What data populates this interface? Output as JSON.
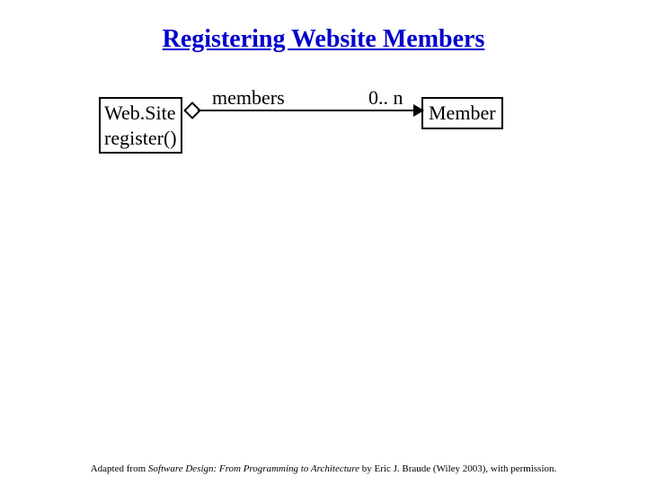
{
  "title": "Registering Website Members",
  "classes": {
    "website": {
      "name": "Web.Site",
      "operation": "register()"
    },
    "member": {
      "name": "Member"
    }
  },
  "association": {
    "role": "members",
    "multiplicity": "0.. n"
  },
  "attribution": {
    "prefix": "Adapted from ",
    "work": "Software Design: From Programming to Architecture",
    "suffix": " by Eric J. Braude (Wiley 2003), with permission."
  }
}
